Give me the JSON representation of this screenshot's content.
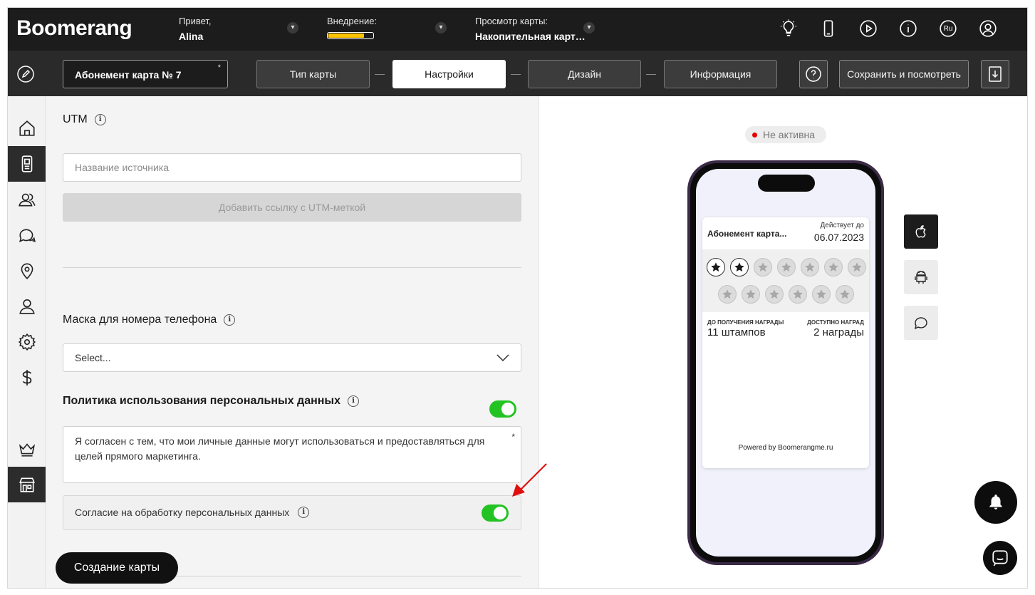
{
  "header": {
    "logo": "Boomerang",
    "greeting_label": "Привет,",
    "user_name": "Alina",
    "onboarding_label": "Внедрение:",
    "onboarding_progress_percent": 80,
    "card_view_label": "Просмотр карты:",
    "card_view_value": "Накопительная карт…",
    "lang": "Ru",
    "progress_color": "#ffc400"
  },
  "nav": {
    "card_name": "Абонемент карта № 7",
    "card_name_required": "*",
    "steps": [
      {
        "label": "Тип карты"
      },
      {
        "label": "Настройки"
      },
      {
        "label": "Дизайн"
      },
      {
        "label": "Информация"
      }
    ],
    "active_step": "Настройки",
    "save_label": "Сохранить и посмотреть"
  },
  "form": {
    "utm_label": "UTM",
    "utm_source_placeholder": "Название источника",
    "utm_add_button": "Добавить ссылку с UTM-меткой",
    "phone_mask_label": "Маска для номера телефона",
    "phone_mask_value": "Select...",
    "policy_label": "Политика использования персональных данных",
    "policy_enabled": true,
    "policy_text": "Я согласен с тем, что мои личные данные могут использоваться и предоставляться для целей прямого маркетинга.",
    "policy_required": "*",
    "consent_label": "Согласие на обработку персональных данных",
    "consent_enabled": true,
    "create_button": "Создание карты",
    "toggle_color": "#22c322"
  },
  "preview": {
    "status": "Не активна",
    "status_color": "#e60000",
    "pass": {
      "title": "Абонемент карта...",
      "valid_label": "Действует до",
      "valid_date": "06.07.2023",
      "stamps_total": 13,
      "stamps_filled": 2,
      "left_label": "ДО ПОЛУЧЕНИЯ НАГРАДЫ",
      "left_value": "11 штампов",
      "right_label": "ДОСТУПНО НАГРАД",
      "right_value": "2 награды",
      "powered": "Powered by Boomerangme.ru"
    },
    "os_buttons": [
      "apple-icon",
      "android-icon",
      "chat-bubble-icon"
    ]
  }
}
